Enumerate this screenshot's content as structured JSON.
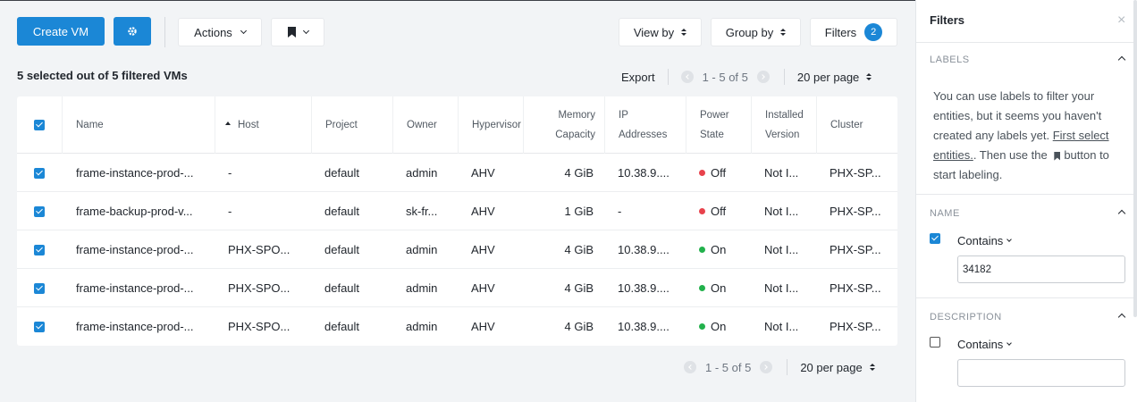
{
  "toolbar": {
    "create_vm_label": "Create VM",
    "actions_label": "Actions",
    "view_by_label": "View by",
    "group_by_label": "Group by",
    "filters_label": "Filters",
    "filters_count": "2"
  },
  "summary": {
    "selected_text": "5 selected out of 5 filtered VMs",
    "export_label": "Export",
    "page_range": "1 - 5 of 5",
    "per_page": "20 per page"
  },
  "table": {
    "headers": {
      "name": "Name",
      "host": "Host",
      "project": "Project",
      "owner": "Owner",
      "hypervisor": "Hypervisor",
      "memory_1": "Memory",
      "memory_2": "Capacity",
      "ip_1": "IP",
      "ip_2": "Addresses",
      "power_1": "Power",
      "power_2": "State",
      "installed_1": "Installed",
      "installed_2": "Version",
      "cluster": "Cluster"
    },
    "rows": [
      {
        "name": "frame-instance-prod-...",
        "host": "-",
        "project": "default",
        "owner": "admin",
        "hypervisor": "AHV",
        "memory": "4 GiB",
        "ip": "10.38.9....",
        "power": "Off",
        "power_color": "#e8424c",
        "installed": "Not I...",
        "cluster": "PHX-SP..."
      },
      {
        "name": "frame-backup-prod-v...",
        "host": "-",
        "project": "default",
        "owner": "sk-fr...",
        "hypervisor": "AHV",
        "memory": "1 GiB",
        "ip": "-",
        "power": "Off",
        "power_color": "#e8424c",
        "installed": "Not I...",
        "cluster": "PHX-SP..."
      },
      {
        "name": "frame-instance-prod-...",
        "host": "PHX-SPO...",
        "project": "default",
        "owner": "admin",
        "hypervisor": "AHV",
        "memory": "4 GiB",
        "ip": "10.38.9....",
        "power": "On",
        "power_color": "#22b14c",
        "installed": "Not I...",
        "cluster": "PHX-SP..."
      },
      {
        "name": "frame-instance-prod-...",
        "host": "PHX-SPO...",
        "project": "default",
        "owner": "admin",
        "hypervisor": "AHV",
        "memory": "4 GiB",
        "ip": "10.38.9....",
        "power": "On",
        "power_color": "#22b14c",
        "installed": "Not I...",
        "cluster": "PHX-SP..."
      },
      {
        "name": "frame-instance-prod-...",
        "host": "PHX-SPO...",
        "project": "default",
        "owner": "admin",
        "hypervisor": "AHV",
        "memory": "4 GiB",
        "ip": "10.38.9....",
        "power": "On",
        "power_color": "#22b14c",
        "installed": "Not I...",
        "cluster": "PHX-SP..."
      }
    ]
  },
  "filters_panel": {
    "title": "Filters",
    "labels_section": "LABELS",
    "labels_text_1": "You can use labels to filter your entities, but it seems you haven't created any labels yet.",
    "labels_link": "First select entities.",
    "labels_text_2": ". Then use the",
    "labels_text_3": "button to start labeling.",
    "name_section": "NAME",
    "name_contains": "Contains",
    "name_value": "34182",
    "description_section": "DESCRIPTION",
    "description_contains": "Contains",
    "description_value": ""
  },
  "colors": {
    "accent": "#1b87d6",
    "power_off": "#e8424c",
    "power_on": "#22b14c"
  }
}
